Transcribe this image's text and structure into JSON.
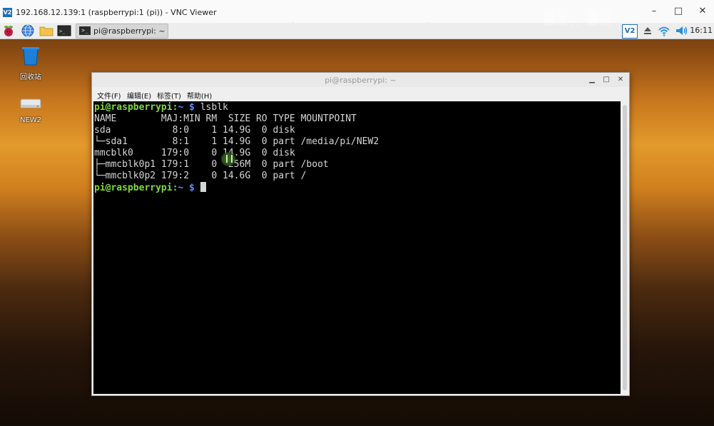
{
  "vnc": {
    "app_icon": "V2",
    "title": "192.168.12.139:1 (raspberrypi:1 (pi)) - VNC Viewer"
  },
  "taskbar": {
    "launchers": [
      "raspberry-menu-icon",
      "globe-browser-icon",
      "folder-icon",
      "terminal-icon"
    ],
    "task": {
      "icon": ">_",
      "label": "pi@raspberrypi: ~"
    },
    "tray": {
      "vnc_badge": "V2",
      "icons": [
        "eject-icon",
        "wifi-icon",
        "volume-icon"
      ]
    },
    "clock": "16:11"
  },
  "desktop": {
    "items": [
      {
        "label": "回收站",
        "icon": "trash-icon"
      },
      {
        "label": "NEW2",
        "icon": "drive-icon"
      }
    ]
  },
  "terminal": {
    "title": "pi@raspberrypi: ~",
    "menu": [
      "文件(F)",
      "编辑(E)",
      "标签(T)",
      "帮助(H)"
    ],
    "prompt": {
      "user": "pi@raspberrypi",
      "colon": ":",
      "path": "~",
      "sign": " $ "
    },
    "command": "lsblk",
    "output": [
      "NAME        MAJ:MIN RM  SIZE RO TYPE MOUNTPOINT",
      "sda           8:0    1 14.9G  0 disk",
      "└─sda1        8:1    1 14.9G  0 part /media/pi/NEW2",
      "mmcblk0     179:0    0 14.9G  0 disk",
      "├─mmcblk0p1 179:1    0  256M  0 part /boot",
      "└─mmcblk0p2 179:2    0 14.6G  0 part /"
    ]
  },
  "colors": {
    "prompt_user": "#7ddc3b",
    "prompt_path": "#5b8cff",
    "terminal_bg": "#000000",
    "terminal_fg": "#d6d6d6"
  }
}
